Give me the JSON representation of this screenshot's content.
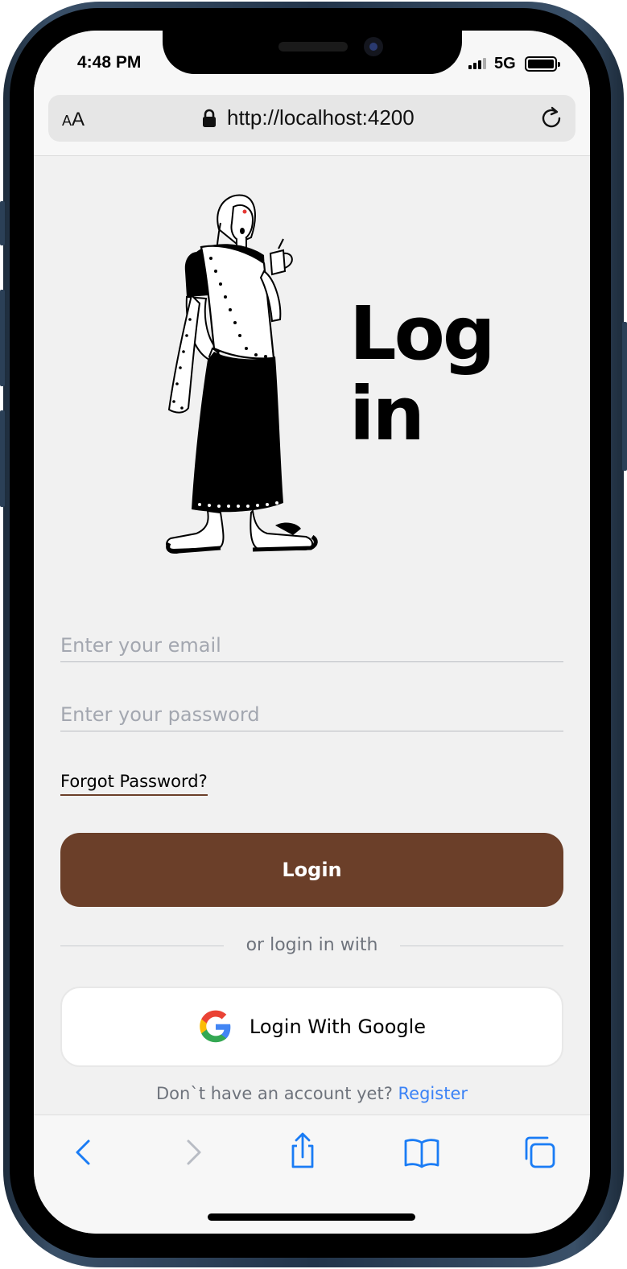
{
  "status_bar": {
    "time": "4:48 PM",
    "network": "5G"
  },
  "browser": {
    "text_size_label_small": "A",
    "text_size_label_big": "A",
    "url": "http://localhost:4200"
  },
  "page": {
    "title_line1": "Log",
    "title_line2": "in",
    "email_placeholder": "Enter your email",
    "password_placeholder": "Enter your password",
    "forgot_password": "Forgot Password?",
    "login_button": "Login",
    "divider_text": "or login in with",
    "google_button": "Login With Google",
    "register_prompt": "Don`t have an account yet?",
    "register_link": "Register"
  },
  "toolbar": {
    "items": [
      "back-icon",
      "forward-icon",
      "share-icon",
      "bookmarks-icon",
      "tabs-icon"
    ]
  },
  "colors": {
    "accent": "#6b3f29",
    "link": "#3b82f6",
    "toolbar_blue": "#1a7cf5",
    "page_bg": "#f1f1f1"
  }
}
